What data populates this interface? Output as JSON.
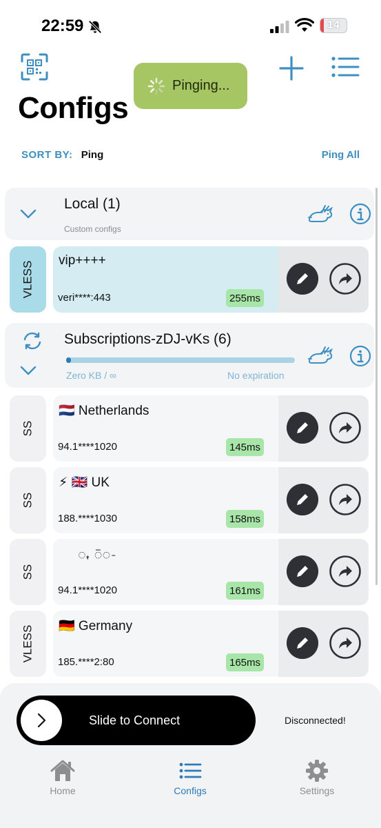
{
  "status_bar": {
    "time": "22:59",
    "battery": "14"
  },
  "header": {
    "title": "Configs",
    "toast": "Pinging...",
    "sort_label": "SORT BY:",
    "sort_value": "Ping",
    "ping_all": "Ping All"
  },
  "groups": [
    {
      "title": "Local (1)",
      "subtitle": "Custom configs"
    },
    {
      "title": "Subscriptions-zDJ-vKs (6)",
      "usage": "Zero KB / ∞",
      "expiry": "No expiration",
      "usage_fraction": 0.02
    }
  ],
  "configs": [
    {
      "type": "VLESS",
      "name": "vip++++",
      "address": "veri****:443",
      "ping": "255ms",
      "active": true
    },
    {
      "type": "SS",
      "name": "🇳🇱 Netherlands",
      "address": "94.1****1020",
      "ping": "145ms"
    },
    {
      "type": "SS",
      "name": "⚡ 🇬🇧 UK",
      "address": "188.****1030",
      "ping": "158ms"
    },
    {
      "type": "SS",
      "name": "ꩻ ꩼꩽ",
      "address": "94.1****1020",
      "ping": "161ms"
    },
    {
      "type": "VLESS",
      "name": "🇩🇪 Germany",
      "address": "185.****2:80",
      "ping": "165ms"
    }
  ],
  "bottom": {
    "slider_label": "Slide to Connect",
    "connection_status": "Disconnected!",
    "tabs": [
      {
        "label": "Home"
      },
      {
        "label": "Configs"
      },
      {
        "label": "Settings"
      }
    ]
  },
  "colors": {
    "accent": "#3d8fc2",
    "toast_bg": "#a6c663",
    "active_card": "#d5ecf3",
    "ping_badge": "#a8e5a8"
  }
}
